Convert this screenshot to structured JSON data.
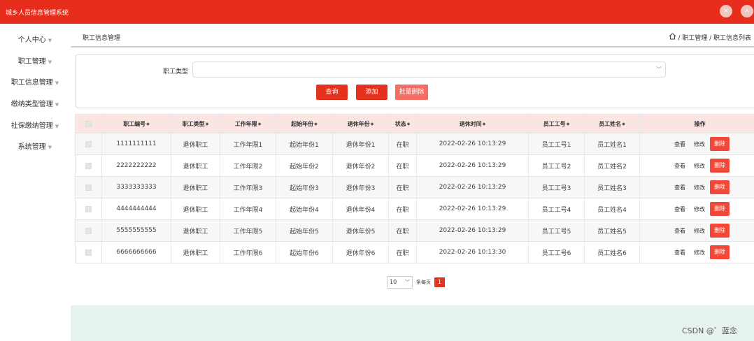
{
  "app": {
    "title": "城乡人员信息管理系统",
    "close_icon": "×",
    "user_icon": "ㅅ"
  },
  "sidebar": {
    "items": [
      {
        "label": "个人中心"
      },
      {
        "label": "职工管理"
      },
      {
        "label": "职工信息管理"
      },
      {
        "label": "缴纳类型管理"
      },
      {
        "label": "社保缴纳管理"
      },
      {
        "label": "系统管理"
      }
    ]
  },
  "breadcrumb": {
    "title": "职工信息管理",
    "path": "/ 职工管理 / 职工信息列表"
  },
  "search": {
    "label": "职工类型",
    "value": "",
    "query_label": "查询",
    "add_label": "添加",
    "bulk_delete_label": "批量删除"
  },
  "table": {
    "columns": [
      "职工编号",
      "职工类型",
      "工作年限",
      "起始年份",
      "退休年份",
      "状态",
      "退休时间",
      "员工工号",
      "员工姓名",
      "操作"
    ],
    "action_labels": {
      "view": "查看",
      "edit": "修改",
      "delete": "删除"
    },
    "rows": [
      {
        "id": "1111111111",
        "type": "退休职工",
        "years": "工作年限1",
        "start": "起始年份1",
        "retire": "退休年份1",
        "status": "在职",
        "time": "2022-02-26 10:13:29",
        "no": "员工工号1",
        "name": "员工姓名1"
      },
      {
        "id": "2222222222",
        "type": "退休职工",
        "years": "工作年限2",
        "start": "起始年份2",
        "retire": "退休年份2",
        "status": "在职",
        "time": "2022-02-26 10:13:29",
        "no": "员工工号2",
        "name": "员工姓名2"
      },
      {
        "id": "3333333333",
        "type": "退休职工",
        "years": "工作年限3",
        "start": "起始年份3",
        "retire": "退休年份3",
        "status": "在职",
        "time": "2022-02-26 10:13:29",
        "no": "员工工号3",
        "name": "员工姓名3"
      },
      {
        "id": "4444444444",
        "type": "退休职工",
        "years": "工作年限4",
        "start": "起始年份4",
        "retire": "退休年份4",
        "status": "在职",
        "time": "2022-02-26 10:13:29",
        "no": "员工工号4",
        "name": "员工姓名4"
      },
      {
        "id": "5555555555",
        "type": "退休职工",
        "years": "工作年限5",
        "start": "起始年份5",
        "retire": "退休年份5",
        "status": "在职",
        "time": "2022-02-26 10:13:29",
        "no": "员工工号5",
        "name": "员工姓名5"
      },
      {
        "id": "6666666666",
        "type": "退休职工",
        "years": "工作年限6",
        "start": "起始年份6",
        "retire": "退休年份6",
        "status": "在职",
        "time": "2022-02-26 10:13:30",
        "no": "员工工号6",
        "name": "员工姓名6"
      }
    ]
  },
  "pagination": {
    "page_size": "10",
    "per_page_label": "条每页",
    "current_page": "1"
  },
  "watermark": "CSDN @゛蓝念",
  "colors": {
    "brand": "#e72d1b",
    "header_row": "#fbe5e3",
    "delete_button": "#f1483a",
    "footer_band": "#e6f2ef"
  }
}
